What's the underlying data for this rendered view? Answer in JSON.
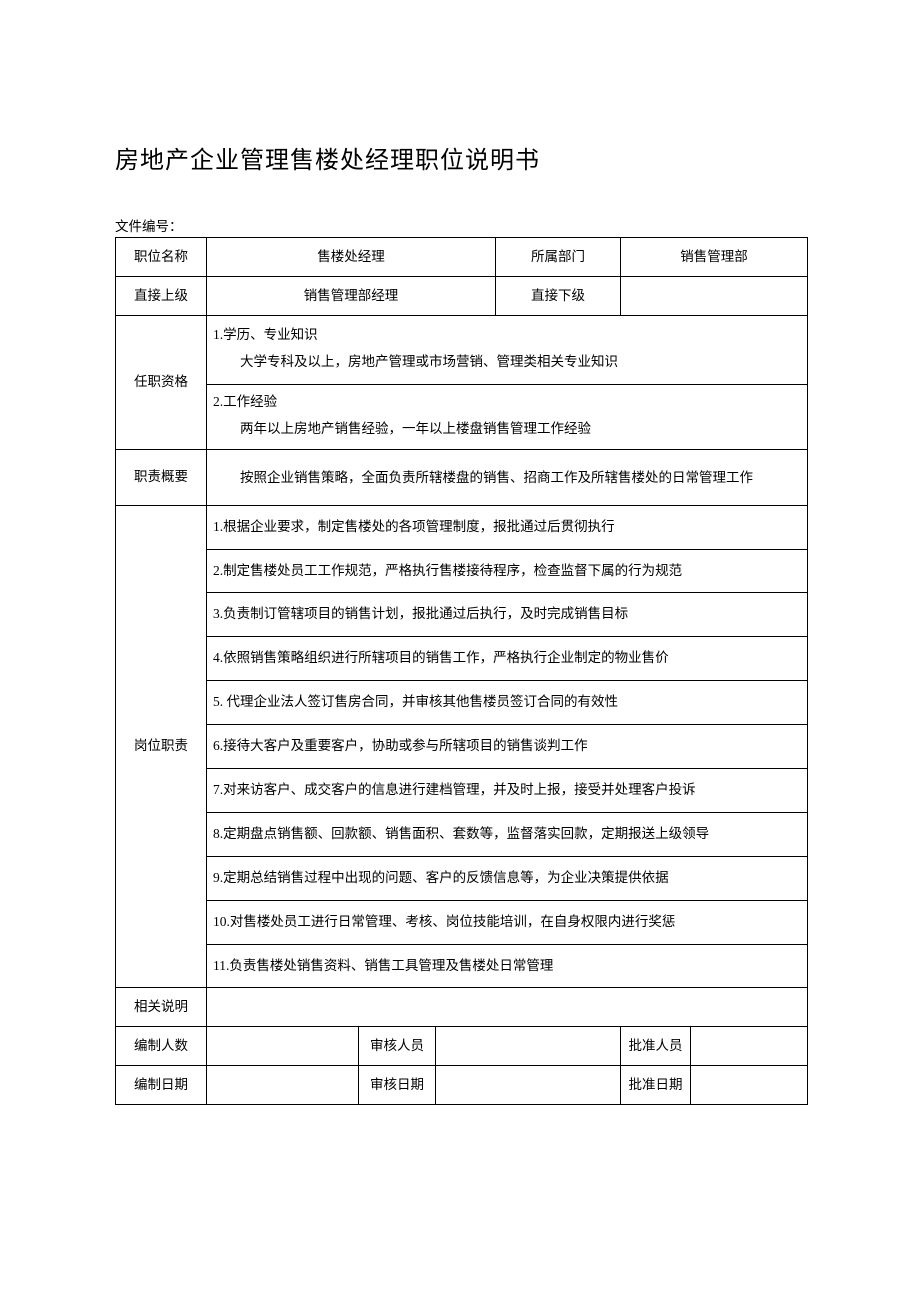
{
  "title": "房地产企业管理售楼处经理职位说明书",
  "doc_no_label": "文件编号：",
  "header": {
    "position_label": "职位名称",
    "position_value": "售楼处经理",
    "dept_label": "所属部门",
    "dept_value": "销售管理部",
    "superior_label": "直接上级",
    "superior_value": "销售管理部经理",
    "subordinate_label": "直接下级",
    "subordinate_value": ""
  },
  "qualification": {
    "label": "任职资格",
    "section1_heading": "1.学历、专业知识",
    "section1_content": "大学专科及以上，房地产管理或市场营销、管理类相关专业知识",
    "section2_heading": "2.工作经验",
    "section2_content": "两年以上房地产销售经验，一年以上楼盘销售管理工作经验"
  },
  "summary": {
    "label": "职责概要",
    "content": "按照企业销售策略，全面负责所辖楼盘的销售、招商工作及所辖售楼处的日常管理工作"
  },
  "duties": {
    "label": "岗位职责",
    "items": [
      "1.根据企业要求，制定售楼处的各项管理制度，报批通过后贯彻执行",
      "2.制定售楼处员工工作规范，严格执行售楼接待程序，检查监督下属的行为规范",
      "3.负责制订管辖项目的销售计划，报批通过后执行，及时完成销售目标",
      "4.依照销售策略组织进行所辖项目的销售工作，严格执行企业制定的物业售价",
      "5. 代理企业法人签订售房合同，并审核其他售楼员签订合同的有效性",
      "6.接待大客户及重要客户，协助或参与所辖项目的销售谈判工作",
      "7.对来访客户、成交客户的信息进行建档管理，并及时上报，接受并处理客户投诉",
      "8.定期盘点销售额、回款额、销售面积、套数等，监督落实回款，定期报送上级领导",
      "9.定期总结销售过程中出现的问题、客户的反馈信息等，为企业决策提供依据",
      "10.对售楼处员工进行日常管理、考核、岗位技能培训，在自身权限内进行奖惩",
      "11.负责售楼处销售资料、销售工具管理及售楼处日常管理"
    ]
  },
  "related_label": "相关说明",
  "footer": {
    "headcount_label": "编制人数",
    "auditor_label": "审核人员",
    "approver_label": "批准人员",
    "create_date_label": "编制日期",
    "audit_date_label": "审核日期",
    "approve_date_label": "批准日期"
  }
}
